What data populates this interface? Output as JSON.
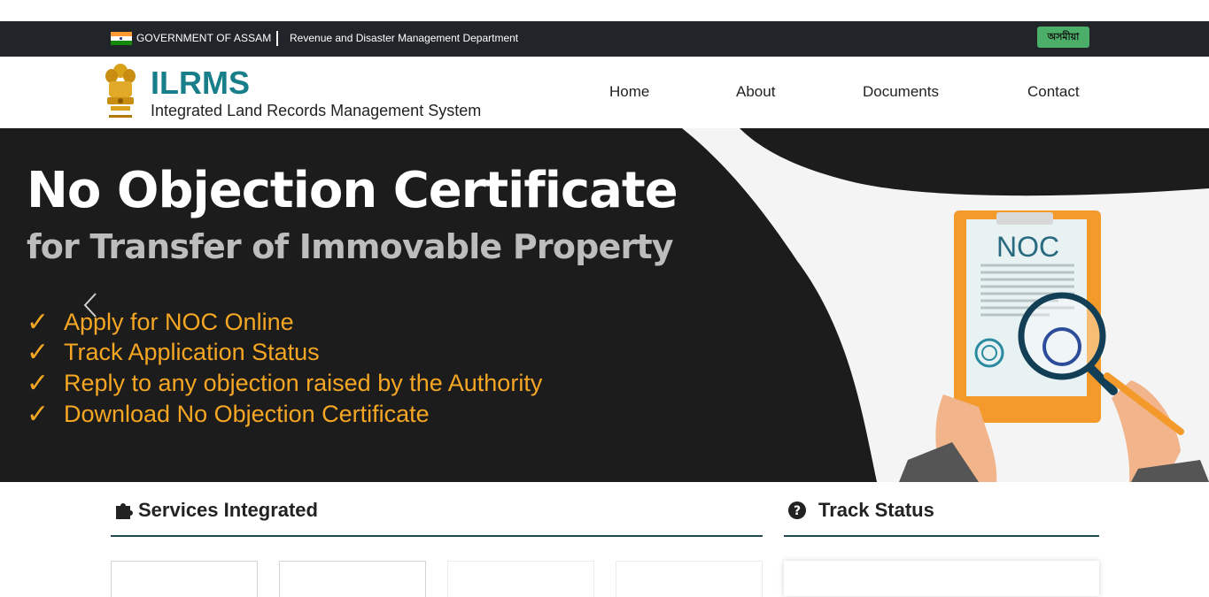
{
  "govbar": {
    "gov_name": "GOVERNMENT OF ASSAM",
    "department": "Revenue and Disaster Management Department",
    "language_button": "অসমীয়া"
  },
  "header": {
    "title": "ILRMS",
    "subtitle": "Integrated Land Records Management System",
    "nav": [
      "Home",
      "About",
      "Documents",
      "Contact"
    ]
  },
  "hero": {
    "title": "No Objection Certificate",
    "subtitle": "for Transfer of Immovable Property",
    "features": [
      "Apply for NOC Online",
      "Track Application Status",
      "Reply to any objection raised by the Authority",
      "Download No Objection Certificate"
    ],
    "illustration_text": "NOC"
  },
  "sections": {
    "services": "Services Integrated",
    "track": "Track Status"
  },
  "colors": {
    "brand": "#187f8a",
    "govbar": "#212529",
    "accent": "#f5a623",
    "language_button": "#4caf69"
  }
}
